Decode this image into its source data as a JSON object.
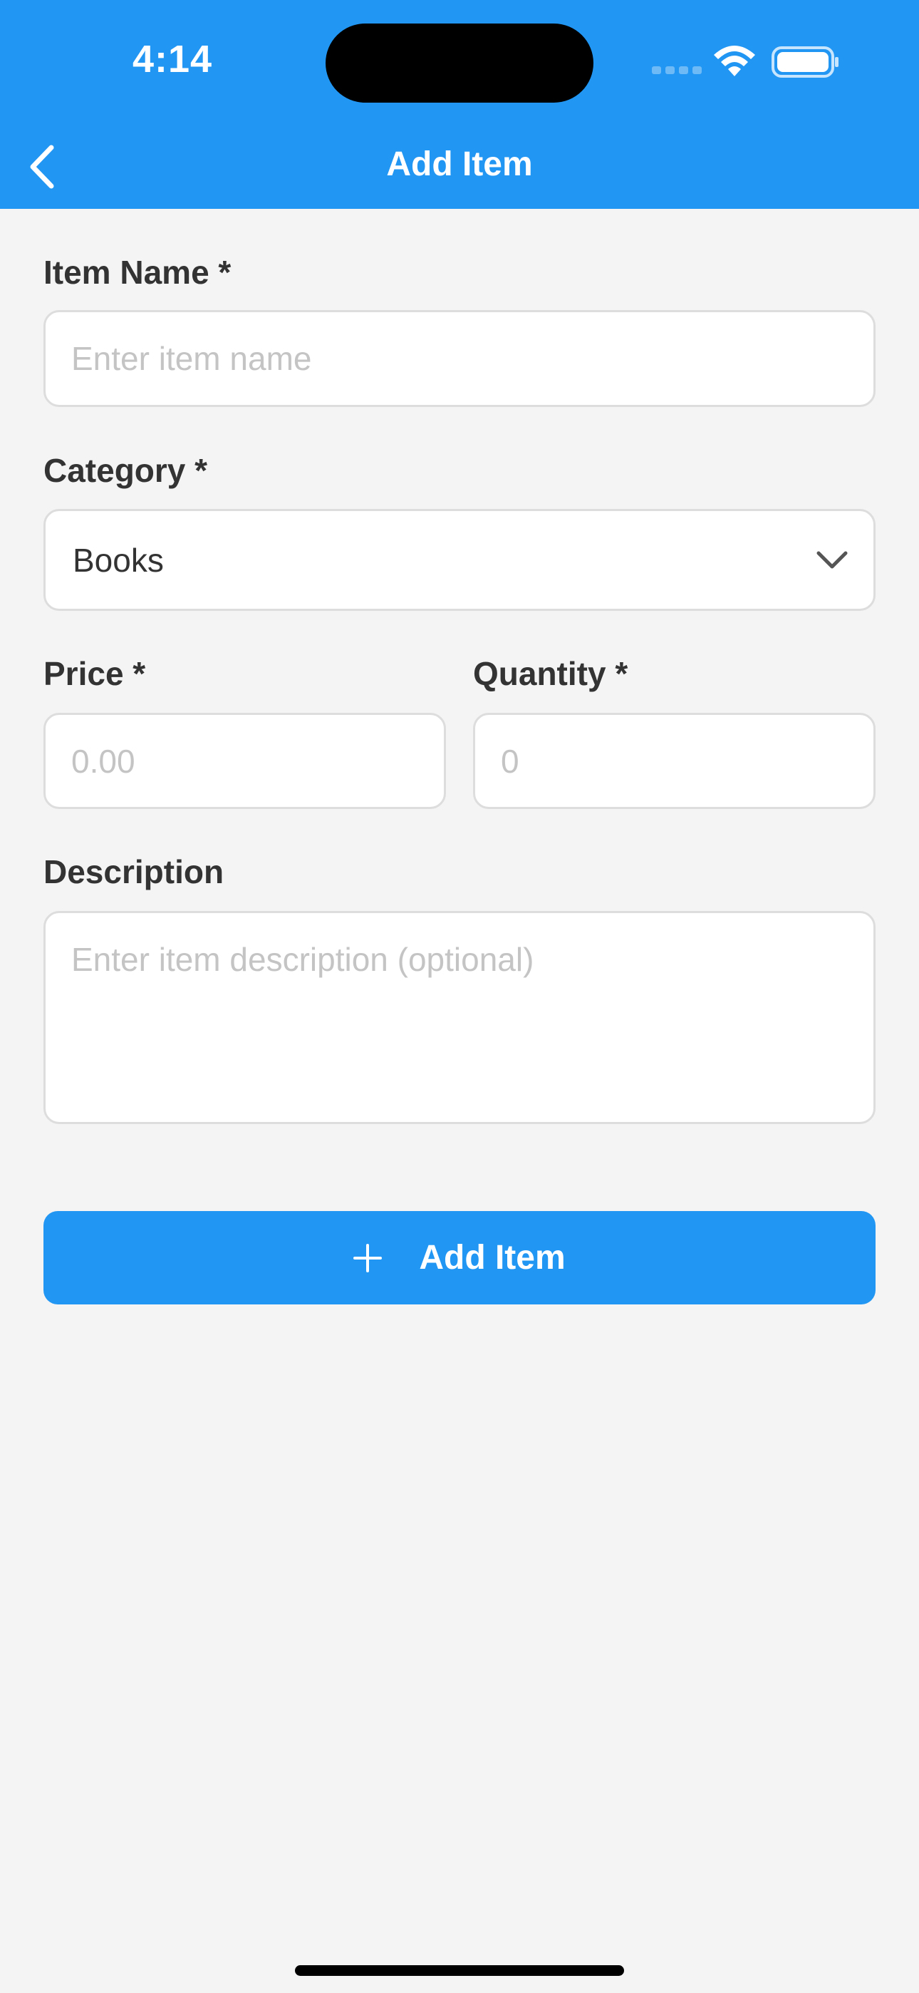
{
  "status_bar": {
    "time": "4:14"
  },
  "nav": {
    "title": "Add Item",
    "back_icon": "chevron-left-icon"
  },
  "form": {
    "item_name": {
      "label": "Item Name *",
      "placeholder": "Enter item name",
      "value": ""
    },
    "category": {
      "label": "Category *",
      "selected": "Books",
      "icon": "chevron-down-icon"
    },
    "price": {
      "label": "Price *",
      "placeholder": "0.00",
      "value": ""
    },
    "quantity": {
      "label": "Quantity *",
      "placeholder": "0",
      "value": ""
    },
    "description": {
      "label": "Description",
      "placeholder": "Enter item description (optional)",
      "value": ""
    },
    "submit": {
      "label": "Add Item",
      "icon": "plus-icon"
    }
  },
  "colors": {
    "primary": "#2196f3",
    "background": "#f4f4f4",
    "label_text": "#333333",
    "placeholder": "#c4c4c4",
    "border": "#dddddd"
  }
}
